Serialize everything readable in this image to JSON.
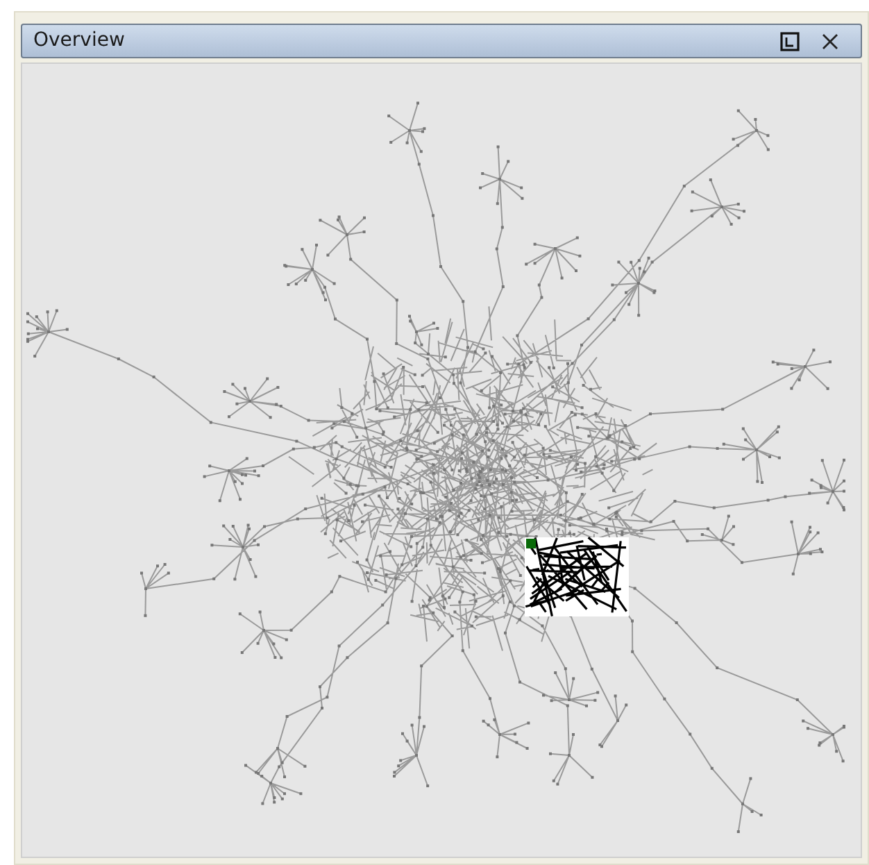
{
  "panel": {
    "title": "Overview"
  }
}
